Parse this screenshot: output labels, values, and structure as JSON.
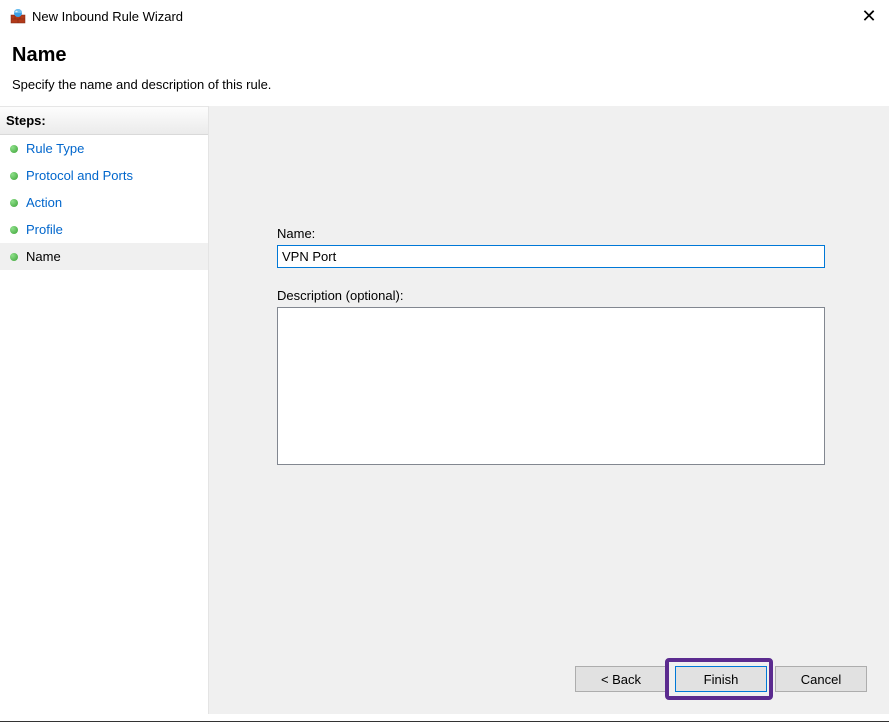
{
  "titlebar": {
    "title": "New Inbound Rule Wizard"
  },
  "header": {
    "heading": "Name",
    "subheading": "Specify the name and description of this rule."
  },
  "sidebar": {
    "steps_label": "Steps:",
    "items": [
      {
        "label": "Rule Type"
      },
      {
        "label": "Protocol and Ports"
      },
      {
        "label": "Action"
      },
      {
        "label": "Profile"
      },
      {
        "label": "Name"
      }
    ]
  },
  "form": {
    "name_label": "Name:",
    "name_value": "VPN Port",
    "description_label": "Description (optional):",
    "description_value": ""
  },
  "buttons": {
    "back": "< Back",
    "finish": "Finish",
    "cancel": "Cancel"
  }
}
